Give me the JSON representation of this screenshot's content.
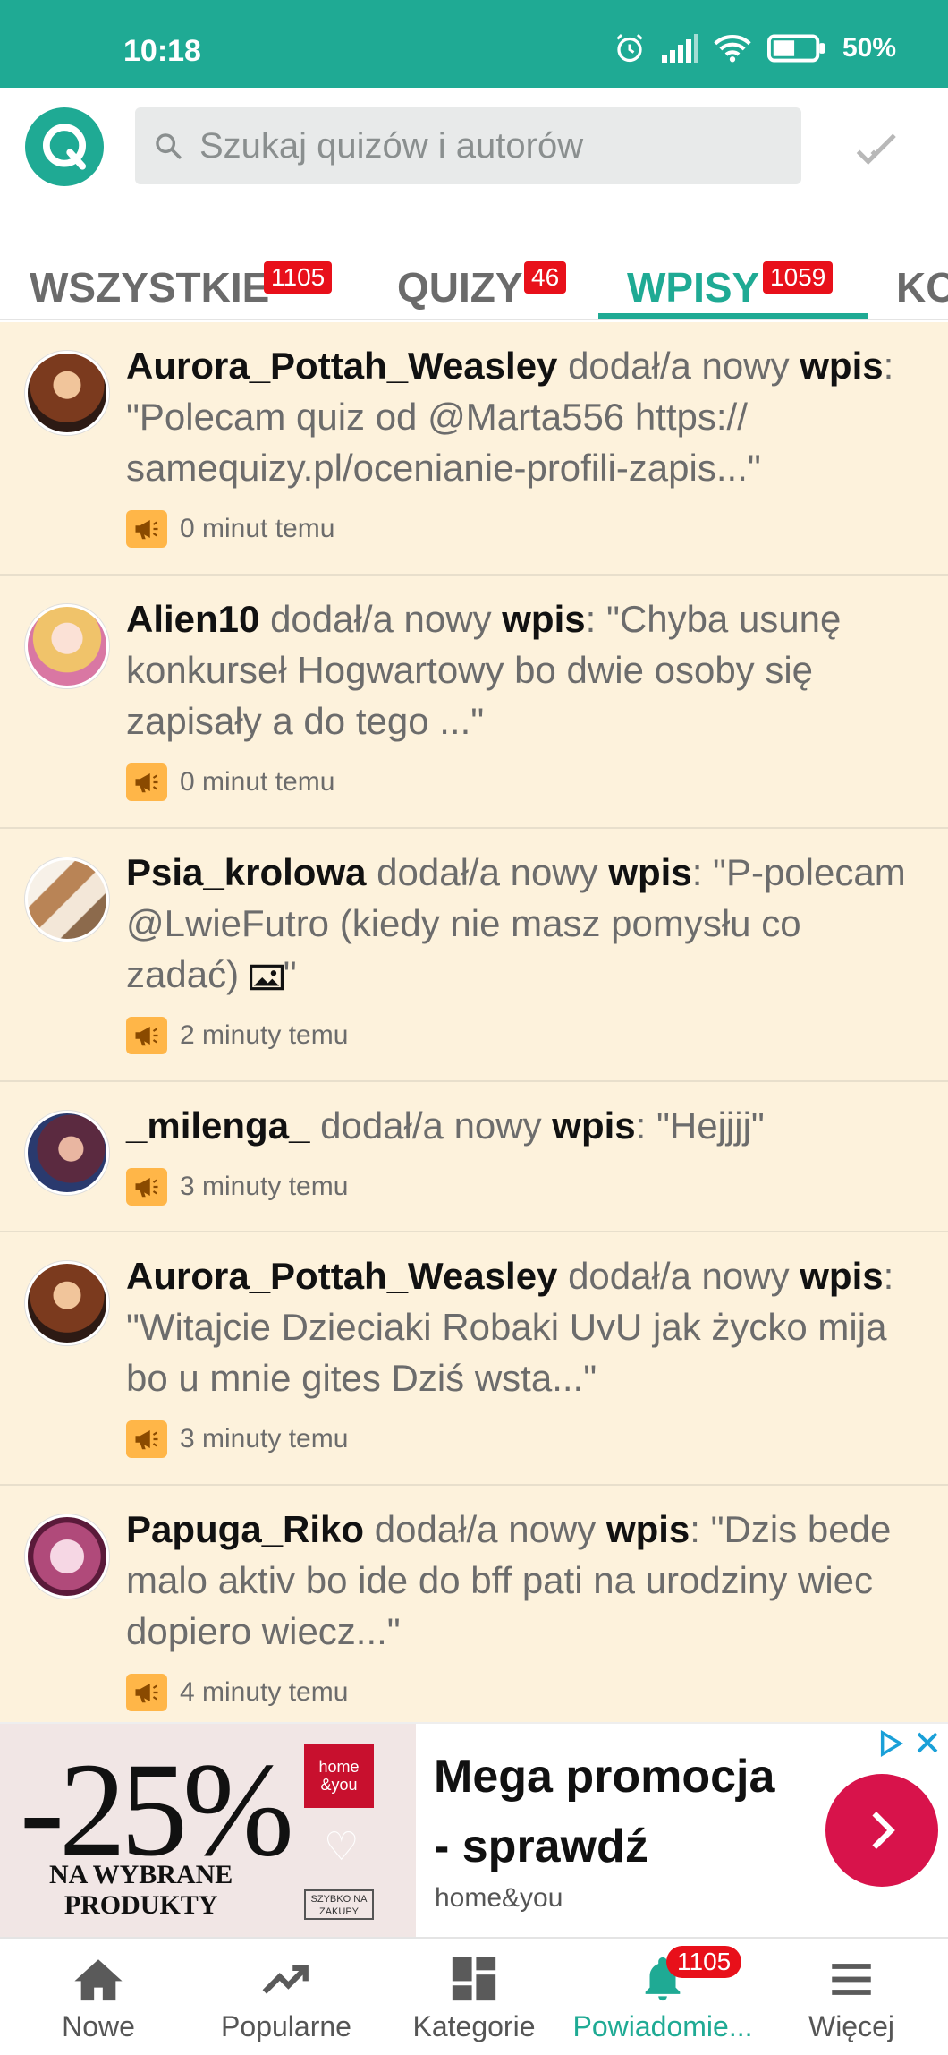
{
  "status_bar": {
    "time": "10:18",
    "battery": "50%"
  },
  "search": {
    "placeholder": "Szukaj quizów i autorów"
  },
  "tabs": [
    {
      "label": "WSZYSTKIE",
      "count": "1105"
    },
    {
      "label": "QUIZY",
      "count": "46"
    },
    {
      "label": "WPISY",
      "count": "1059",
      "active": true
    },
    {
      "label": "KO"
    }
  ],
  "feed": [
    {
      "user": "Aurora_Pottah_Weasley",
      "action": " dodał/a nowy ",
      "kind": "wpis",
      "sep": ": ",
      "quote": "\"Polecam quiz od @Marta556 https:// samequizy.pl/ocenianie-profili-zapis...\"",
      "time": "0 minut temu"
    },
    {
      "user": "Alien10",
      "action": " dodał/a nowy ",
      "kind": "wpis",
      "sep": ": ",
      "quote": "\"Chyba usunę konkurseł Hogwartowy bo dwie osoby się zapisały a do tego ...\"",
      "time": "0 minut temu"
    },
    {
      "user": "Psia_krolowa",
      "action": " dodał/a nowy ",
      "kind": "wpis",
      "sep": ": ",
      "quote": "\"P-polecam @LwieFutro (kiedy nie masz pomysłu co zadać) ",
      "quote_end": "\"",
      "time": "2 minuty temu"
    },
    {
      "user": "_milenga_",
      "action": " dodał/a nowy ",
      "kind": "wpis",
      "sep": ": ",
      "quote": "\"Hejjjj\"",
      "time": "3 minuty temu"
    },
    {
      "user": "Aurora_Pottah_Weasley",
      "action": " dodał/a nowy ",
      "kind": "wpis",
      "sep": ": ",
      "quote": "\"Witajcie Dzieciaki Robaki UvU jak życko mija bo u mnie gites Dziś wsta...\"",
      "time": "3 minuty temu"
    },
    {
      "user": "Papuga_Riko",
      "action": " dodał/a nowy ",
      "kind": "wpis",
      "sep": ": ",
      "quote": "\"Dzis bede malo aktiv bo ide do bff pati na urodziny wiec dopiero wiecz...\"",
      "time": "4 minuty temu"
    }
  ],
  "ad": {
    "percent": "-25%",
    "sub_line1": "NA WYBRANE",
    "sub_line2": "PRODUKTY",
    "logo_text": "home &you",
    "box_text": "SZYBKO NA ZAKUPY",
    "title_line1": "Mega promocja",
    "title_line2": "- sprawdź",
    "brand": "home&you"
  },
  "bottom_nav": [
    {
      "label": "Nowe",
      "icon": "home-icon"
    },
    {
      "label": "Popularne",
      "icon": "trending-icon"
    },
    {
      "label": "Kategorie",
      "icon": "dashboard-icon"
    },
    {
      "label": "Powiadomie...",
      "icon": "bell-icon",
      "badge": "1105",
      "active": true
    },
    {
      "label": "Więcej",
      "icon": "menu-icon"
    }
  ],
  "colors": {
    "accent": "#1faa94",
    "badge": "#e8101a",
    "feed_bg": "#fdf2dc"
  }
}
